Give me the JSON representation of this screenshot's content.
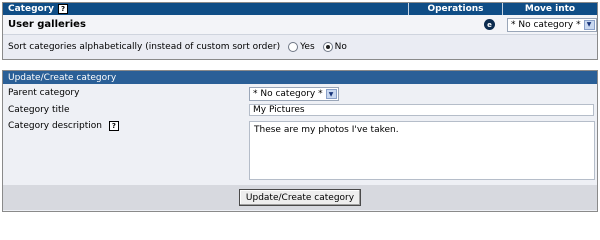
{
  "table": {
    "headers": {
      "category": "Category",
      "operations": "Operations",
      "move_into": "Move into"
    },
    "help_icon": "?",
    "row": {
      "name": "User galleries",
      "edit_icon": "e",
      "move_select_value": "* No category *"
    },
    "sort_setting": {
      "label": "Sort categories alphabetically (instead of custom sort order)",
      "options": [
        {
          "label": "Yes",
          "selected": false
        },
        {
          "label": "No",
          "selected": true
        }
      ]
    }
  },
  "form": {
    "title": "Update/Create category",
    "parent_label": "Parent category",
    "parent_value": "* No category *",
    "title_label": "Category title",
    "title_value": "My Pictures",
    "description_label": "Category description",
    "help_icon": "?",
    "description_value": "These are my photos I've taken.",
    "submit_label": "Update/Create category"
  },
  "colors": {
    "header_bg": "#0f4d86",
    "panel_header_bg": "#2a5f97",
    "row_bg": "#eef0f5"
  }
}
